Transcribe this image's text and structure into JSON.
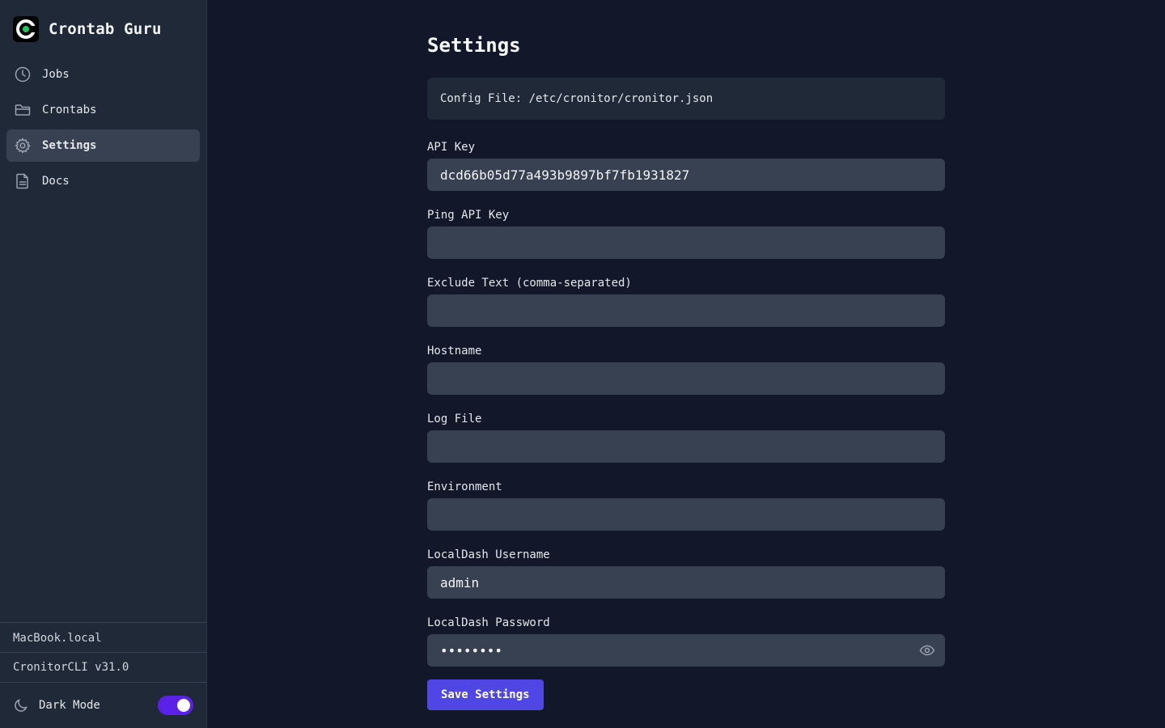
{
  "app": {
    "name": "Crontab Guru"
  },
  "sidebar": {
    "items": [
      {
        "label": "Jobs",
        "icon": "clock-icon"
      },
      {
        "label": "Crontabs",
        "icon": "folder-icon"
      },
      {
        "label": "Settings",
        "icon": "gear-icon",
        "active": true
      },
      {
        "label": "Docs",
        "icon": "document-icon"
      }
    ],
    "hostname": "MacBook.local",
    "version": "CronitorCLI v31.0",
    "dark_mode_label": "Dark Mode",
    "dark_mode_on": true
  },
  "settings": {
    "title": "Settings",
    "config_file": "Config File: /etc/cronitor/cronitor.json",
    "fields": [
      {
        "label": "API Key",
        "value": "dcd66b05d77a493b9897bf7fb1931827"
      },
      {
        "label": "Ping API Key",
        "value": ""
      },
      {
        "label": "Exclude Text (comma-separated)",
        "value": ""
      },
      {
        "label": "Hostname",
        "value": ""
      },
      {
        "label": "Log File",
        "value": ""
      },
      {
        "label": "Environment",
        "value": ""
      },
      {
        "label": "LocalDash Username",
        "value": "admin"
      },
      {
        "label": "LocalDash Password",
        "value": "••••••••"
      }
    ],
    "save_label": "Save Settings"
  },
  "colors": {
    "accent": "#4f46e5",
    "toggle": "#5b21e6",
    "logo_accent": "#22c55e"
  }
}
